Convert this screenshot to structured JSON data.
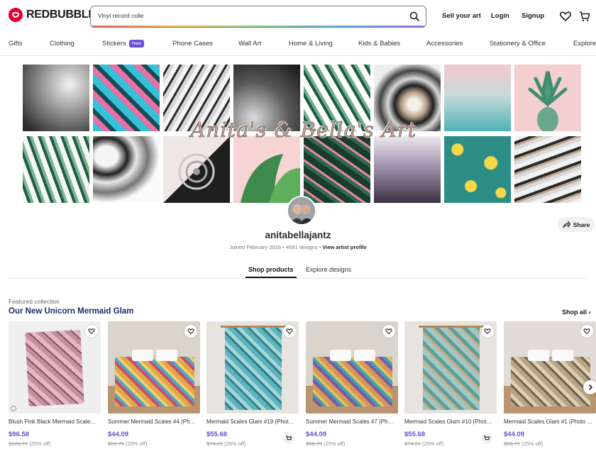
{
  "header": {
    "brand": "REDBUBBLE",
    "search_value": "Vinyl record colle",
    "sell_label": "Sell your art",
    "login_label": "Login",
    "signup_label": "Signup"
  },
  "nav": {
    "items": [
      "Gifts",
      "Clothing",
      "Stickers",
      "Phone Cases",
      "Wall Art",
      "Home & Living",
      "Kids & Babies",
      "Accessories",
      "Stationery & Office",
      "Explore"
    ],
    "new_badge": "New"
  },
  "banner": {
    "title": "Anita's & Bella's Art"
  },
  "profile": {
    "username": "anitabellajantz",
    "joined": "Joined February 2016",
    "designs": "4691 designs",
    "view_profile": "View artist profile",
    "share_label": "Share"
  },
  "tabs": {
    "shop": "Shop products",
    "explore": "Explore designs"
  },
  "collection": {
    "kicker": "Featured collection",
    "title": "Our New Unicorn Mermaid Glam",
    "shop_all": "Shop all",
    "products": [
      {
        "title": "Blush Pink Black Mermaid Scales...",
        "price": "$96.58",
        "original": "$128.77",
        "discount": "(25% off)"
      },
      {
        "title": "Summer Mermaid Scales #4 (Pho...",
        "price": "$44.09",
        "original": "$58.79",
        "discount": "(25% off)"
      },
      {
        "title": "Mermaid Scales Glam #19 (Photo...",
        "price": "$55.68",
        "original": "$74.23",
        "discount": "(25% off)"
      },
      {
        "title": "Summer Mermaid Scales #7 (Pho...",
        "price": "$44.09",
        "original": "$58.79",
        "discount": "(25% off)"
      },
      {
        "title": "Mermaid Scales Glam #10 (Photo...",
        "price": "$55.68",
        "original": "$74.23",
        "discount": "(25% off)"
      },
      {
        "title": "Mermaid Scales Glam #1 (Photo ...",
        "price": "$44.09",
        "original": "$58.79",
        "discount": "(25% off)"
      }
    ]
  },
  "colors": {
    "brand_red": "#e4002b",
    "price_purple": "#6b4ddb",
    "heading_navy": "#1d2a6b"
  }
}
